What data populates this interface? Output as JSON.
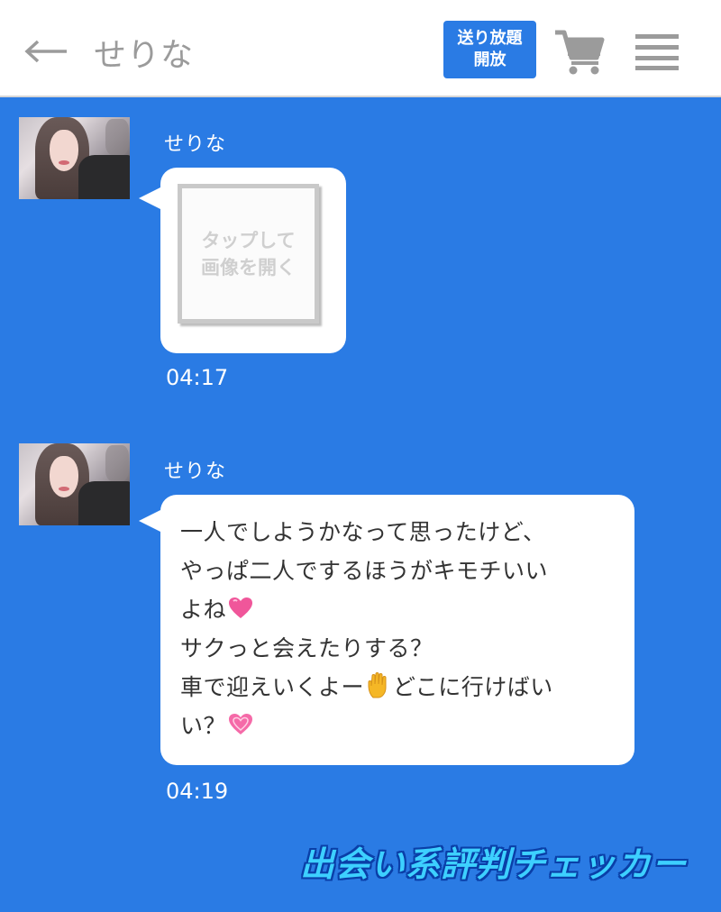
{
  "header": {
    "back_icon": "back-arrow-icon",
    "title": "せりな",
    "unlimited_button": {
      "line1": "送り放題",
      "line2": "開放"
    },
    "cart_icon": "cart-icon",
    "menu_icon": "hamburger-menu-icon"
  },
  "messages": [
    {
      "sender": "せりな",
      "image_placeholder": {
        "line1": "タップして",
        "line2": "画像を開く"
      },
      "time": "04:17"
    },
    {
      "sender": "せりな",
      "lines": [
        "一人でしようかなって思ったけど、",
        "やっぱ二人でするほうがキモチいい",
        "よね",
        "サクっと会えたりする？",
        "車で迎えいくよー",
        "どこに行けばい",
        "い？"
      ],
      "time": "04:19"
    }
  ],
  "watermark": "出会い系評判チェッカー",
  "colors": {
    "background": "#2a7be4",
    "header": "#ffffff",
    "accent_button": "#2a7be4",
    "watermark": "#3dd0ff"
  }
}
